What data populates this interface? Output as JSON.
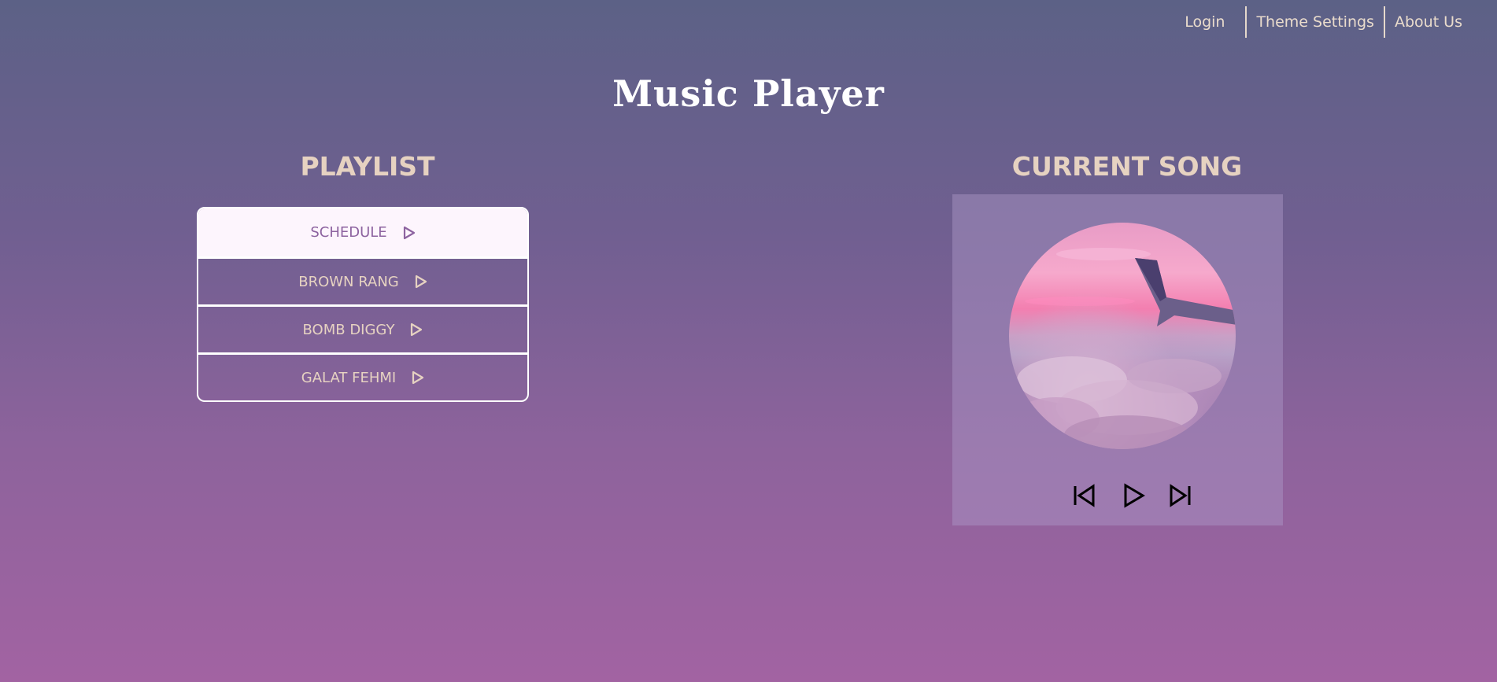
{
  "nav": {
    "login": "Login",
    "theme_settings": "Theme Settings",
    "about_us": "About Us"
  },
  "page_title": "Music Player",
  "playlist": {
    "heading": "PLAYLIST",
    "tracks": [
      {
        "title": "SCHEDULE",
        "active": true
      },
      {
        "title": "BROWN RANG",
        "active": false
      },
      {
        "title": "BOMB DIGGY",
        "active": false
      },
      {
        "title": "GALAT FEHMI",
        "active": false
      }
    ]
  },
  "current_song": {
    "heading": "CURRENT SONG"
  },
  "icons": {
    "track_play": "play-icon",
    "prev": "skip-previous-icon",
    "play": "play-icon",
    "next": "skip-next-icon"
  },
  "colors": {
    "heading": "#e6d2c1",
    "active_track_bg": "#fdf5fd",
    "active_track_text": "#8d63a0"
  }
}
